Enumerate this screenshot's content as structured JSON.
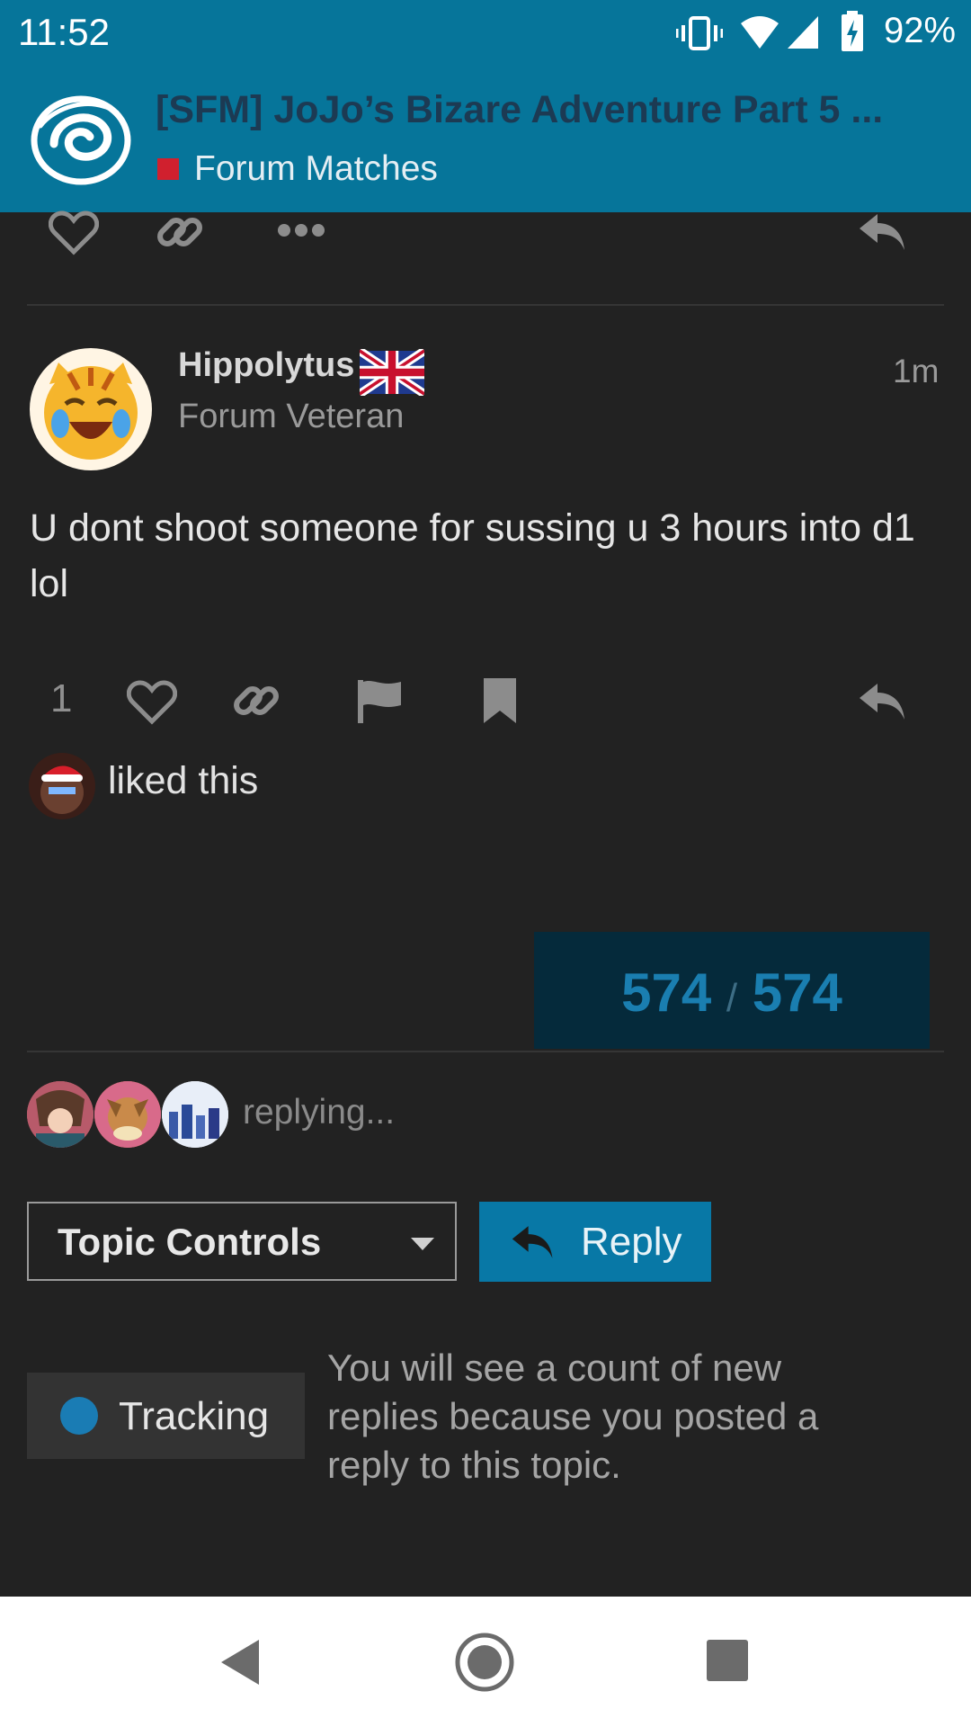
{
  "status_bar": {
    "time": "11:52",
    "battery": "92%",
    "icons": [
      "vibrate-icon",
      "wifi-icon",
      "cell-signal-icon",
      "battery-charging-icon"
    ]
  },
  "header": {
    "topic_title": "[SFM] JoJo’s Bizare Adventure Part 5 ...",
    "category": "Forum Matches",
    "category_color": "#d0202e",
    "logo": "swirl-logo-icon",
    "background": "#06759a"
  },
  "prev_post_actions": [
    "heart-icon",
    "link-icon",
    "more-icon",
    "reply-icon"
  ],
  "post": {
    "username": "Hippolytus",
    "user_title": "Forum Veteran",
    "flag": "uk-flag-icon",
    "age": "1m",
    "body": "U dont shoot someone for sussing u 3 hours into d1 lol",
    "like_count": "1",
    "actions": [
      "heart-icon",
      "link-icon",
      "flag-icon",
      "bookmark-icon",
      "reply-icon"
    ],
    "liked_text": "liked this"
  },
  "progress": {
    "current": "574",
    "separator": "/",
    "total": "574"
  },
  "replying": {
    "text": "replying...",
    "avatars": 3
  },
  "controls": {
    "topic_controls_label": "Topic Controls",
    "reply_label": "Reply"
  },
  "notification": {
    "level_label": "Tracking",
    "description": "You will see a count of new replies because you posted a reply to this topic.",
    "dot_color": "#1a7cb4"
  },
  "nav_bar": [
    "back-icon",
    "home-icon",
    "recents-icon"
  ],
  "colors": {
    "accent": "#0878a6",
    "background": "#222222"
  }
}
